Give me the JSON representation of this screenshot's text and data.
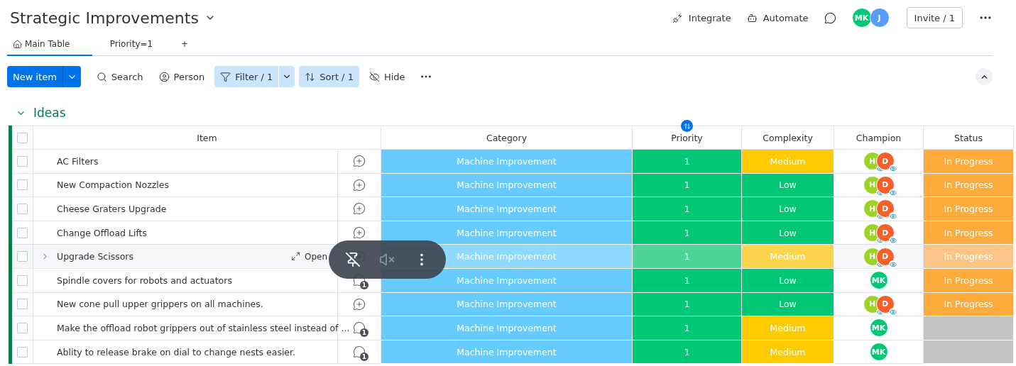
{
  "board": {
    "title": "Strategic Improvements"
  },
  "header_actions": [
    {
      "kind": "integrate",
      "label": "Integrate"
    },
    {
      "kind": "automate",
      "label": "Automate"
    }
  ],
  "members": [
    {
      "initials": "MK",
      "color": "#00c875"
    },
    {
      "initials": "J",
      "color": "#579bfc"
    }
  ],
  "invite": {
    "label": "Invite / 1"
  },
  "tabs": [
    {
      "label": "Main Table",
      "kind": "home",
      "selected": true
    },
    {
      "label": "Priority=1",
      "kind": "view",
      "selected": false
    },
    {
      "label": "+",
      "kind": "add",
      "selected": false
    }
  ],
  "toolbar": {
    "new_item": "New item",
    "tools": [
      {
        "kind": "search",
        "label": "Search",
        "active": false
      },
      {
        "kind": "person",
        "label": "Person",
        "active": false
      },
      {
        "kind": "filter",
        "label": "Filter / 1",
        "active": true
      },
      {
        "kind": "sort",
        "label": "Sort / 1",
        "active": true
      },
      {
        "kind": "hide",
        "label": "Hide",
        "active": false
      }
    ]
  },
  "group": {
    "title": "Ideas",
    "color": "#037f4c",
    "expanded": true
  },
  "table": {
    "all_checked": false,
    "columns": [
      "Item",
      "Category",
      "Priority",
      "Complexity",
      "Champion",
      "Status"
    ],
    "rows": [
      {
        "item": "AC Filters",
        "checked": false,
        "hovered": false,
        "update_count": null,
        "category": {
          "text": "Machine Improvement",
          "color": "#66ccff"
        },
        "priority": {
          "text": "1",
          "color": "#00c875"
        },
        "complexity": {
          "text": "Medium",
          "color": "#ffcb00"
        },
        "champion": [
          {
            "initials": "H",
            "color": "#9cd326"
          },
          {
            "initials": "D",
            "color": "#f65f2a"
          }
        ],
        "status": {
          "text": "In Progress",
          "color": "#fdab3d"
        }
      },
      {
        "item": "New Compaction Nozzles",
        "checked": false,
        "hovered": false,
        "update_count": null,
        "category": {
          "text": "Machine Improvement",
          "color": "#66ccff"
        },
        "priority": {
          "text": "1",
          "color": "#00c875"
        },
        "complexity": {
          "text": "Low",
          "color": "#00c875"
        },
        "champion": [
          {
            "initials": "H",
            "color": "#9cd326"
          },
          {
            "initials": "D",
            "color": "#f65f2a"
          }
        ],
        "status": {
          "text": "In Progress",
          "color": "#fdab3d"
        }
      },
      {
        "item": "Cheese Graters Upgrade",
        "checked": false,
        "hovered": false,
        "update_count": null,
        "category": {
          "text": "Machine Improvement",
          "color": "#66ccff"
        },
        "priority": {
          "text": "1",
          "color": "#00c875"
        },
        "complexity": {
          "text": "Low",
          "color": "#00c875"
        },
        "champion": [
          {
            "initials": "H",
            "color": "#9cd326"
          },
          {
            "initials": "D",
            "color": "#f65f2a"
          }
        ],
        "status": {
          "text": "In Progress",
          "color": "#fdab3d"
        }
      },
      {
        "item": "Change Offload Lifts",
        "checked": false,
        "hovered": false,
        "update_count": null,
        "category": {
          "text": "Machine Improvement",
          "color": "#66ccff"
        },
        "priority": {
          "text": "1",
          "color": "#00c875"
        },
        "complexity": {
          "text": "Low",
          "color": "#00c875"
        },
        "champion": [
          {
            "initials": "H",
            "color": "#9cd326"
          },
          {
            "initials": "D",
            "color": "#f65f2a"
          }
        ],
        "status": {
          "text": "In Progress",
          "color": "#fdab3d"
        }
      },
      {
        "item": "Upgrade Scissors",
        "checked": false,
        "hovered": true,
        "open_label": "Open",
        "update_count": null,
        "category": {
          "text": "Machine Improvement",
          "color": "#8fd9ff"
        },
        "priority": {
          "text": "1",
          "color": "#4cd49a"
        },
        "complexity": {
          "text": "Medium",
          "color": "#fcd54c"
        },
        "champion": [
          {
            "initials": "H",
            "color": "#9cd326"
          },
          {
            "initials": "D",
            "color": "#f65f2a"
          }
        ],
        "status": {
          "text": "In Progress",
          "color": "#fbc488"
        }
      },
      {
        "item": "Spindle covers for robots and actuators",
        "checked": false,
        "hovered": false,
        "update_count": "1",
        "category": {
          "text": "Machine Improvement",
          "color": "#66ccff"
        },
        "priority": {
          "text": "1",
          "color": "#00c875"
        },
        "complexity": {
          "text": "Low",
          "color": "#00c875"
        },
        "champion": [
          {
            "initials": "MK",
            "color": "#00c875"
          }
        ],
        "status": {
          "text": "In Progress",
          "color": "#fdab3d"
        }
      },
      {
        "item": "New cone pull upper grippers on all machines.",
        "checked": false,
        "hovered": false,
        "update_count": null,
        "category": {
          "text": "Machine Improvement",
          "color": "#66ccff"
        },
        "priority": {
          "text": "1",
          "color": "#00c875"
        },
        "complexity": {
          "text": "Low",
          "color": "#00c875"
        },
        "champion": [
          {
            "initials": "H",
            "color": "#9cd326"
          },
          {
            "initials": "D",
            "color": "#f65f2a"
          }
        ],
        "status": {
          "text": "In Progress",
          "color": "#fdab3d"
        }
      },
      {
        "item": "Make the offload robot grippers out of stainless steel instead of ...",
        "checked": false,
        "hovered": false,
        "update_count": "1",
        "category": {
          "text": "Machine Improvement",
          "color": "#66ccff"
        },
        "priority": {
          "text": "1",
          "color": "#00c875"
        },
        "complexity": {
          "text": "Medium",
          "color": "#ffcb00"
        },
        "champion": [
          {
            "initials": "MK",
            "color": "#00c875"
          }
        ],
        "status": {
          "color": "#c4c4c4"
        }
      },
      {
        "item": "Ablity to release brake on dial to change nests easier.",
        "checked": false,
        "hovered": false,
        "update_count": "1",
        "category": {
          "text": "Machine Improvement",
          "color": "#66ccff"
        },
        "priority": {
          "text": "1",
          "color": "#00c875"
        },
        "complexity": {
          "text": "Medium",
          "color": "#ffcb00"
        },
        "champion": [
          {
            "initials": "MK",
            "color": "#00c875"
          }
        ],
        "status": {
          "color": "#c4c4c4"
        }
      }
    ]
  },
  "call_overlay": {
    "visible": true
  }
}
